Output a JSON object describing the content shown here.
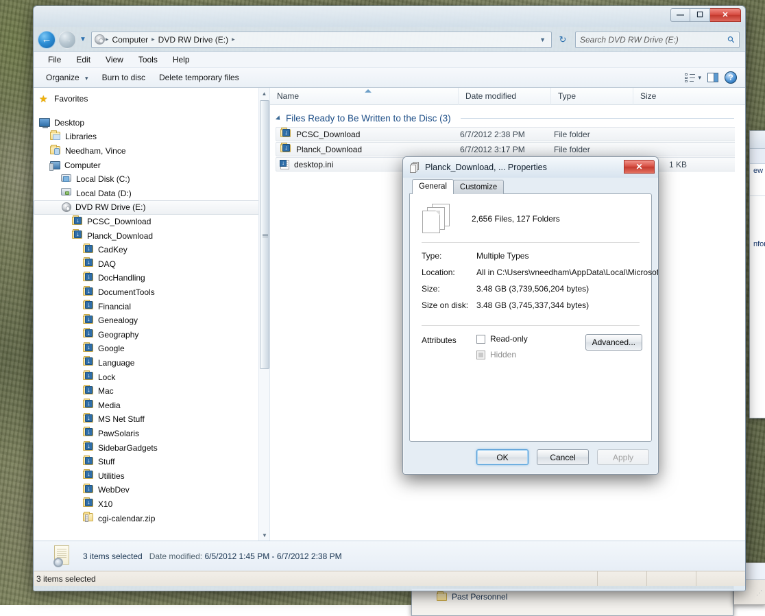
{
  "window": {
    "controls": {
      "minimize": "—",
      "maximize": "☐",
      "close": "✕"
    }
  },
  "addressbar": {
    "back_glyph": "←",
    "forward_glyph": "→",
    "history_caret": "▼",
    "drive_icon": "dvd-disc-icon",
    "crumbs": [
      "Computer",
      "DVD RW Drive (E:)"
    ],
    "separator": "▸",
    "dropdown_caret": "▼",
    "refresh_glyph": "↻"
  },
  "search": {
    "placeholder": "Search DVD RW Drive (E:)",
    "icon_glyph": "⚲"
  },
  "menubar": {
    "items": [
      "File",
      "Edit",
      "View",
      "Tools",
      "Help"
    ]
  },
  "commandbar": {
    "organize": "Organize",
    "organize_caret": "▾",
    "burn": "Burn to disc",
    "delete_temp": "Delete temporary files",
    "views_caret": "▾",
    "help_glyph": "?"
  },
  "navpane": {
    "favorites": "Favorites",
    "items": [
      {
        "label": "Desktop",
        "indent": 0,
        "icon": "desktop-icon",
        "selected": false
      },
      {
        "label": "Libraries",
        "indent": 1,
        "icon": "library-folder-icon",
        "selected": false
      },
      {
        "label": "Needham, Vince",
        "indent": 1,
        "icon": "user-folder-icon",
        "selected": false
      },
      {
        "label": "Computer",
        "indent": 1,
        "icon": "computer-icon",
        "selected": false
      },
      {
        "label": "Local Disk (C:)",
        "indent": 2,
        "icon": "system-drive-icon",
        "selected": false
      },
      {
        "label": "Local Data (D:)",
        "indent": 2,
        "icon": "data-drive-icon",
        "selected": false
      },
      {
        "label": "DVD RW Drive (E:)",
        "indent": 2,
        "icon": "dvd-disc-icon",
        "selected": true
      },
      {
        "label": "PCSC_Download",
        "indent": 3,
        "icon": "download-folder-icon",
        "selected": false
      },
      {
        "label": "Planck_Download",
        "indent": 3,
        "icon": "download-folder-icon",
        "selected": false
      },
      {
        "label": "CadKey",
        "indent": 4,
        "icon": "download-folder-icon",
        "selected": false
      },
      {
        "label": "DAQ",
        "indent": 4,
        "icon": "download-folder-icon",
        "selected": false
      },
      {
        "label": "DocHandling",
        "indent": 4,
        "icon": "download-folder-icon",
        "selected": false
      },
      {
        "label": "DocumentTools",
        "indent": 4,
        "icon": "download-folder-icon",
        "selected": false
      },
      {
        "label": "Financial",
        "indent": 4,
        "icon": "download-folder-icon",
        "selected": false
      },
      {
        "label": "Genealogy",
        "indent": 4,
        "icon": "download-folder-icon",
        "selected": false
      },
      {
        "label": "Geography",
        "indent": 4,
        "icon": "download-folder-icon",
        "selected": false
      },
      {
        "label": "Google",
        "indent": 4,
        "icon": "download-folder-icon",
        "selected": false
      },
      {
        "label": "Language",
        "indent": 4,
        "icon": "download-folder-icon",
        "selected": false
      },
      {
        "label": "Lock",
        "indent": 4,
        "icon": "download-folder-icon",
        "selected": false
      },
      {
        "label": "Mac",
        "indent": 4,
        "icon": "download-folder-icon",
        "selected": false
      },
      {
        "label": "Media",
        "indent": 4,
        "icon": "download-folder-icon",
        "selected": false
      },
      {
        "label": "MS Net Stuff",
        "indent": 4,
        "icon": "download-folder-icon",
        "selected": false
      },
      {
        "label": "PawSolaris",
        "indent": 4,
        "icon": "download-folder-icon",
        "selected": false
      },
      {
        "label": "SidebarGadgets",
        "indent": 4,
        "icon": "download-folder-icon",
        "selected": false
      },
      {
        "label": "Stuff",
        "indent": 4,
        "icon": "download-folder-icon",
        "selected": false
      },
      {
        "label": "Utilities",
        "indent": 4,
        "icon": "download-folder-icon",
        "selected": false
      },
      {
        "label": "WebDev",
        "indent": 4,
        "icon": "download-folder-icon",
        "selected": false
      },
      {
        "label": "X10",
        "indent": 4,
        "icon": "download-folder-icon",
        "selected": false
      },
      {
        "label": "cgi-calendar.zip",
        "indent": 4,
        "icon": "zip-folder-icon",
        "selected": false
      }
    ]
  },
  "filelist": {
    "columns": [
      "Name",
      "Date modified",
      "Type",
      "Size"
    ],
    "group": {
      "title": "Files Ready to Be Written to the Disc (3)"
    },
    "rows": [
      {
        "name": "PCSC_Download",
        "date": "6/7/2012 2:38 PM",
        "type": "File folder",
        "size": "",
        "icon": "download-folder-icon"
      },
      {
        "name": "Planck_Download",
        "date": "6/7/2012 3:17 PM",
        "type": "File folder",
        "size": "",
        "icon": "download-folder-icon"
      },
      {
        "name": "desktop.ini",
        "date": "",
        "type": "",
        "size": "1 KB",
        "icon": "ini-file-icon"
      }
    ]
  },
  "detailspane": {
    "selection": "3 items selected",
    "date_label": "Date modified:",
    "date_value": "6/5/2012 1:45 PM - 6/7/2012 2:38 PM"
  },
  "statusbar": {
    "text": "3 items selected"
  },
  "dialog": {
    "title": "Planck_Download, ... Properties",
    "close_glyph": "✕",
    "tabs": [
      {
        "label": "General",
        "active": true
      },
      {
        "label": "Customize",
        "active": false
      }
    ],
    "summary": "2,656 Files,  127 Folders",
    "fields": [
      {
        "key": "Type:",
        "value": "Multiple Types"
      },
      {
        "key": "Location:",
        "value": "All in C:\\Users\\vneedham\\AppData\\Local\\Microsoft"
      },
      {
        "key": "Size:",
        "value": "3.48 GB (3,739,506,204 bytes)"
      },
      {
        "key": "Size on disk:",
        "value": "3.48 GB (3,745,337,344 bytes)"
      }
    ],
    "attributes": {
      "label": "Attributes",
      "readonly": "Read-only",
      "hidden": "Hidden",
      "advanced": "Advanced..."
    },
    "buttons": {
      "ok": "OK",
      "cancel": "Cancel",
      "apply": "Apply"
    }
  },
  "background_windows": {
    "right_text_1": "ew fo",
    "right_text_2": "nform",
    "bottom_label": "Past Personnel"
  },
  "colors": {
    "accent_blue": "#1d4e87",
    "close_red": "#c43a2f",
    "selection_blue": "#4f9ad6",
    "folder_yellow": "#f6dd91"
  }
}
